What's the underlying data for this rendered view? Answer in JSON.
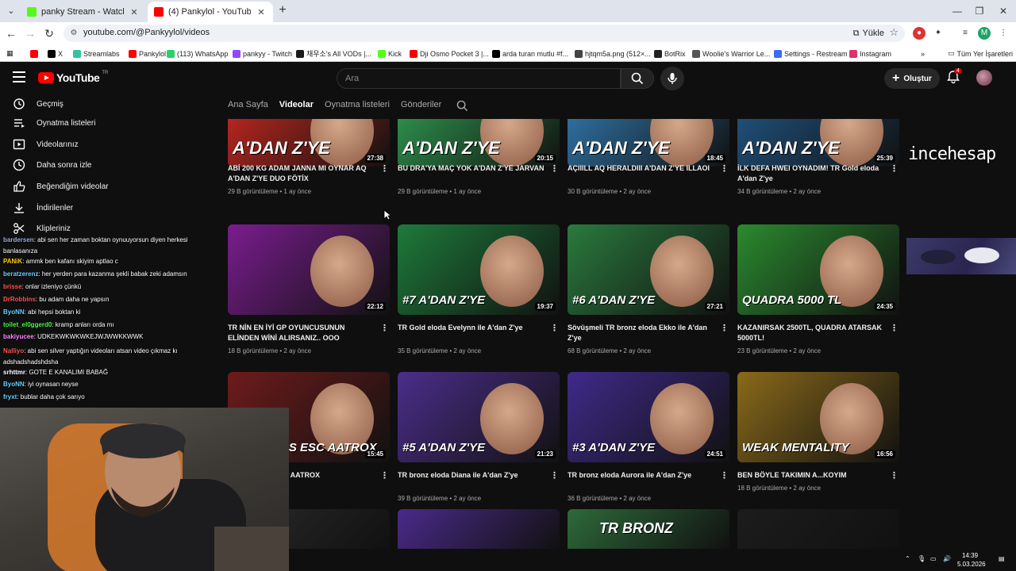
{
  "browser": {
    "tabs": [
      {
        "title": "panky Stream - Watch Live on Kick",
        "active": false,
        "favicon_color": "#53fc18"
      },
      {
        "title": "(4) Pankylol - YouTube",
        "active": true,
        "favicon_color": "#ff0000"
      }
    ],
    "new_tab": "+",
    "url": "youtube.com/@Pankyylol/videos",
    "install_label": "Yükle",
    "bookmarks": [
      {
        "label": "",
        "color": "#ff0000"
      },
      {
        "label": "X",
        "color": "#000000"
      },
      {
        "label": "Streamlabs",
        "color": "#31c3a2"
      },
      {
        "label": "Pankylol",
        "color": "#ff0000"
      },
      {
        "label": "(113) WhatsApp",
        "color": "#25d366"
      },
      {
        "label": "pankyy - Twitch",
        "color": "#9146ff"
      },
      {
        "label": "채우소's All VODs |...",
        "color": "#1a1a1a"
      },
      {
        "label": "Kick",
        "color": "#53fc18"
      },
      {
        "label": "Dji Osmo Pocket 3 |...",
        "color": "#ff0000"
      },
      {
        "label": "arda turan mutlu #f...",
        "color": "#000000"
      },
      {
        "label": "hjtqm5a.png (512×...",
        "color": "#444444"
      },
      {
        "label": "BotRix",
        "color": "#222222"
      },
      {
        "label": "Woolie's Warrior Le...",
        "color": "#555555"
      },
      {
        "label": "Settings - Restream",
        "color": "#3b6cf6"
      },
      {
        "label": "Instagram",
        "color": "#e1306c"
      }
    ],
    "all_bookmarks": "Tüm Yer İşaretleri"
  },
  "youtube": {
    "logo_word": "YouTube",
    "logo_region": "TR",
    "search_placeholder": "Ara",
    "create_label": "Oluştur",
    "notification_count": "4",
    "sidebar": [
      {
        "label": "Geçmiş",
        "icon": "history-icon"
      },
      {
        "label": "Oynatma listeleri",
        "icon": "playlist-icon"
      },
      {
        "label": "Videolarınız",
        "icon": "your-videos-icon"
      },
      {
        "label": "Daha sonra izle",
        "icon": "watch-later-icon"
      },
      {
        "label": "Beğendiğim videolar",
        "icon": "liked-icon"
      },
      {
        "label": "İndirilenler",
        "icon": "download-icon"
      },
      {
        "label": "Klipleriniz",
        "icon": "scissors-icon"
      }
    ],
    "channel_tabs": [
      "Ana Sayfa",
      "Videolar",
      "Oynatma listeleri",
      "Gönderiler"
    ],
    "active_tab": "Videolar",
    "videos": [
      {
        "title": "ABİ 200 KG ADAM JANNA MI OYNAR AQ A'DAN Z'YE DUO FÖTİX",
        "views": "29 B görüntüleme",
        "age": "1 ay önce",
        "duration": "27:38",
        "overlay": "A'DAN Z'YE",
        "bg": "#b3261e"
      },
      {
        "title": "BU DRA'YA MAÇ YOK A'DAN Z'YE JARVAN",
        "views": "29 B görüntüleme",
        "age": "1 ay önce",
        "duration": "20:15",
        "overlay": "A'DAN Z'YE",
        "bg": "#2d8c4a"
      },
      {
        "title": "AÇIIILL AQ HERALDIII A'DAN Z'YE ILLAOI",
        "views": "30 B görüntüleme",
        "age": "2 ay önce",
        "duration": "18:45",
        "overlay": "A'DAN Z'YE",
        "bg": "#2e6f9e"
      },
      {
        "title": "İLK DEFA HWEI OYNADIM! TR Gold eloda A'dan Z'ye",
        "views": "34 B görüntüleme",
        "age": "2 ay önce",
        "duration": "25:39",
        "overlay": "A'DAN Z'YE",
        "bg": "#1f4f78"
      },
      {
        "title": "TR NİN EN İYİ GP OYUNCUSUNUN ELİNDEN WİNİ ALIRSANIZ.. OOO",
        "views": "18 B görüntüleme",
        "age": "2 ay önce",
        "duration": "22:12",
        "overlay": "",
        "bg": "#7a1d8e"
      },
      {
        "title": "TR Gold eloda Evelynn ile A'dan Z'ye",
        "views": "35 B görüntüleme",
        "age": "2 ay önce",
        "duration": "19:37",
        "overlay": "#7 A'DAN Z'YE",
        "bg": "#1e7a3a"
      },
      {
        "title": "Sövüşmeli TR bronz eloda Ekko ile A'dan Z'ye",
        "views": "68 B görüntüleme",
        "age": "2 ay önce",
        "duration": "27:21",
        "overlay": "#6 A'DAN Z'YE",
        "bg": "#2a7a3d"
      },
      {
        "title": "KAZANIRSAK 2500TL, QUADRA ATARSAK 5000TL!",
        "views": "23 B görüntüleme",
        "age": "2 ay önce",
        "duration": "24:35",
        "overlay": "QUADRA 5000 TL",
        "bg": "#2b8a2f"
      },
      {
        "title": "C AATROX",
        "views": "",
        "age": "",
        "duration": "15:45",
        "overlay": "C GRAGAS ESC AATROX",
        "bg": "#6e1b1b"
      },
      {
        "title": "TR bronz eloda Diana ile A'dan Z'ye",
        "views": "39 B görüntüleme",
        "age": "2 ay önce",
        "duration": "21:23",
        "overlay": "#5 A'DAN Z'YE",
        "bg": "#4b2e8a"
      },
      {
        "title": "TR bronz eloda Aurora ile A'dan Z'ye",
        "views": "36 B görüntüleme",
        "age": "2 ay önce",
        "duration": "24:51",
        "overlay": "#3 A'DAN Z'YE",
        "bg": "#3f2a8a"
      },
      {
        "title": "BEN BÖYLE TAKIMIN A...KOYIM",
        "views": "18 B görüntüleme",
        "age": "2 ay önce",
        "duration": "16:56",
        "overlay": "WEAK MENTALITY",
        "bg": "#8a6a1a"
      }
    ],
    "bottom_row": [
      {
        "bg": "#2a2a2a"
      },
      {
        "bg": "#4a2a8a"
      },
      {
        "bg": "#2e6a3a",
        "overlay": "TR BRONZ"
      },
      {
        "bg": "#1c1c1c"
      }
    ]
  },
  "stream_overlay": {
    "watermark": "incehesap",
    "chat": [
      {
        "nick": "bardersen",
        "msg": ": abi sen her zaman boktan oynuuyorsun diyen herkesi banlasanıza",
        "color": "#9ad"
      },
      {
        "nick": "PANiK",
        "msg": ": ammk ben kafanı skiyim aptlao c",
        "color": "#ffd400"
      },
      {
        "nick": "beratzerenz",
        "msg": ": her yerden para kazanma şekli babak zeki adamsın",
        "color": "#6cf"
      },
      {
        "nick": "brisse",
        "msg": ": onlar izleniyo çünkü",
        "color": "#f55"
      },
      {
        "nick": "DrRobbins",
        "msg": ": bu adam daha ne yapsın",
        "color": "#f55"
      },
      {
        "nick": "ByoNN",
        "msg": ": abi hepsi boktan ki",
        "color": "#6cf"
      },
      {
        "nick": "toilet_el0ggerd0",
        "msg": ": kramp anları orda mı",
        "color": "#4f4"
      },
      {
        "nick": "bakiyucee",
        "msg": ": UDKEKWKWKWKEJWJWWKKWWK",
        "color": "#f8f"
      },
      {
        "nick": "Nalliyo",
        "msg": ": abi sen silver yaptığın videoları atsan video çıkmaz kı adshadshadshdsha",
        "color": "#f55"
      },
      {
        "nick": "srhttmr",
        "msg": ": GOTE E KANALIMI BABAĞ",
        "color": "#fff"
      },
      {
        "nick": "ByoNN",
        "msg": ": iyi oynasan neyse",
        "color": "#6cf"
      },
      {
        "nick": "fryxt",
        "msg": ": bublar daha çok sarıyo",
        "color": "#6cf"
      }
    ]
  },
  "taskbar": {
    "time": "14:39",
    "date": "5.03.2026"
  }
}
